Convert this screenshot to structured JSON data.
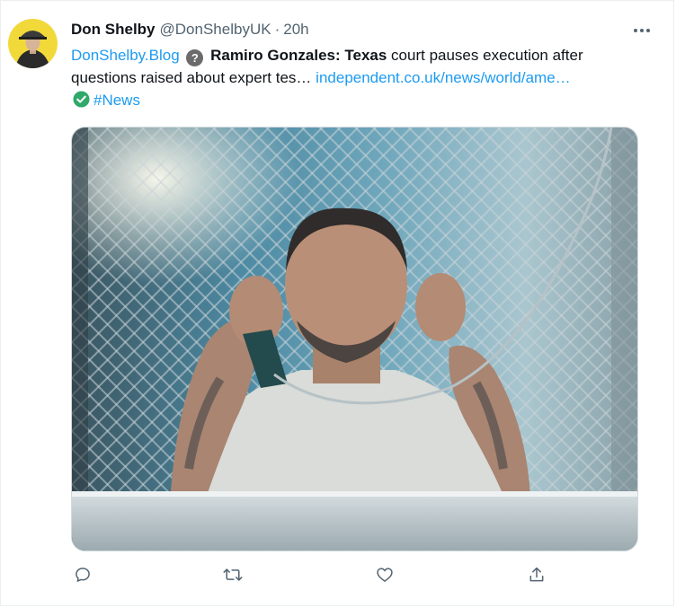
{
  "tweet": {
    "display_name": "Don Shelby",
    "handle": "@DonShelbyUK",
    "separator": "·",
    "time": "20h",
    "text": {
      "source_link": "DonShelby.Blog",
      "source_badge": "?",
      "headline_bold": "Ramiro Gonzales: Texas",
      "headline_rest": " court pauses execution after",
      "line2": "questions raised about expert tes… ",
      "url": "independent.co.uk/news/world/ame…",
      "hashtag": "#News"
    }
  },
  "icons": {
    "more": "more-horizontal-icon",
    "reply": "reply-icon",
    "retweet": "retweet-icon",
    "like": "heart-icon",
    "share": "share-icon",
    "verified": "check-circle-icon",
    "source": "question-mark-icon"
  },
  "colors": {
    "link": "#1d9bf0",
    "text": "#0f1419",
    "muted": "#536471",
    "check": "#2fa86a",
    "badge": "#6b6b6b"
  }
}
